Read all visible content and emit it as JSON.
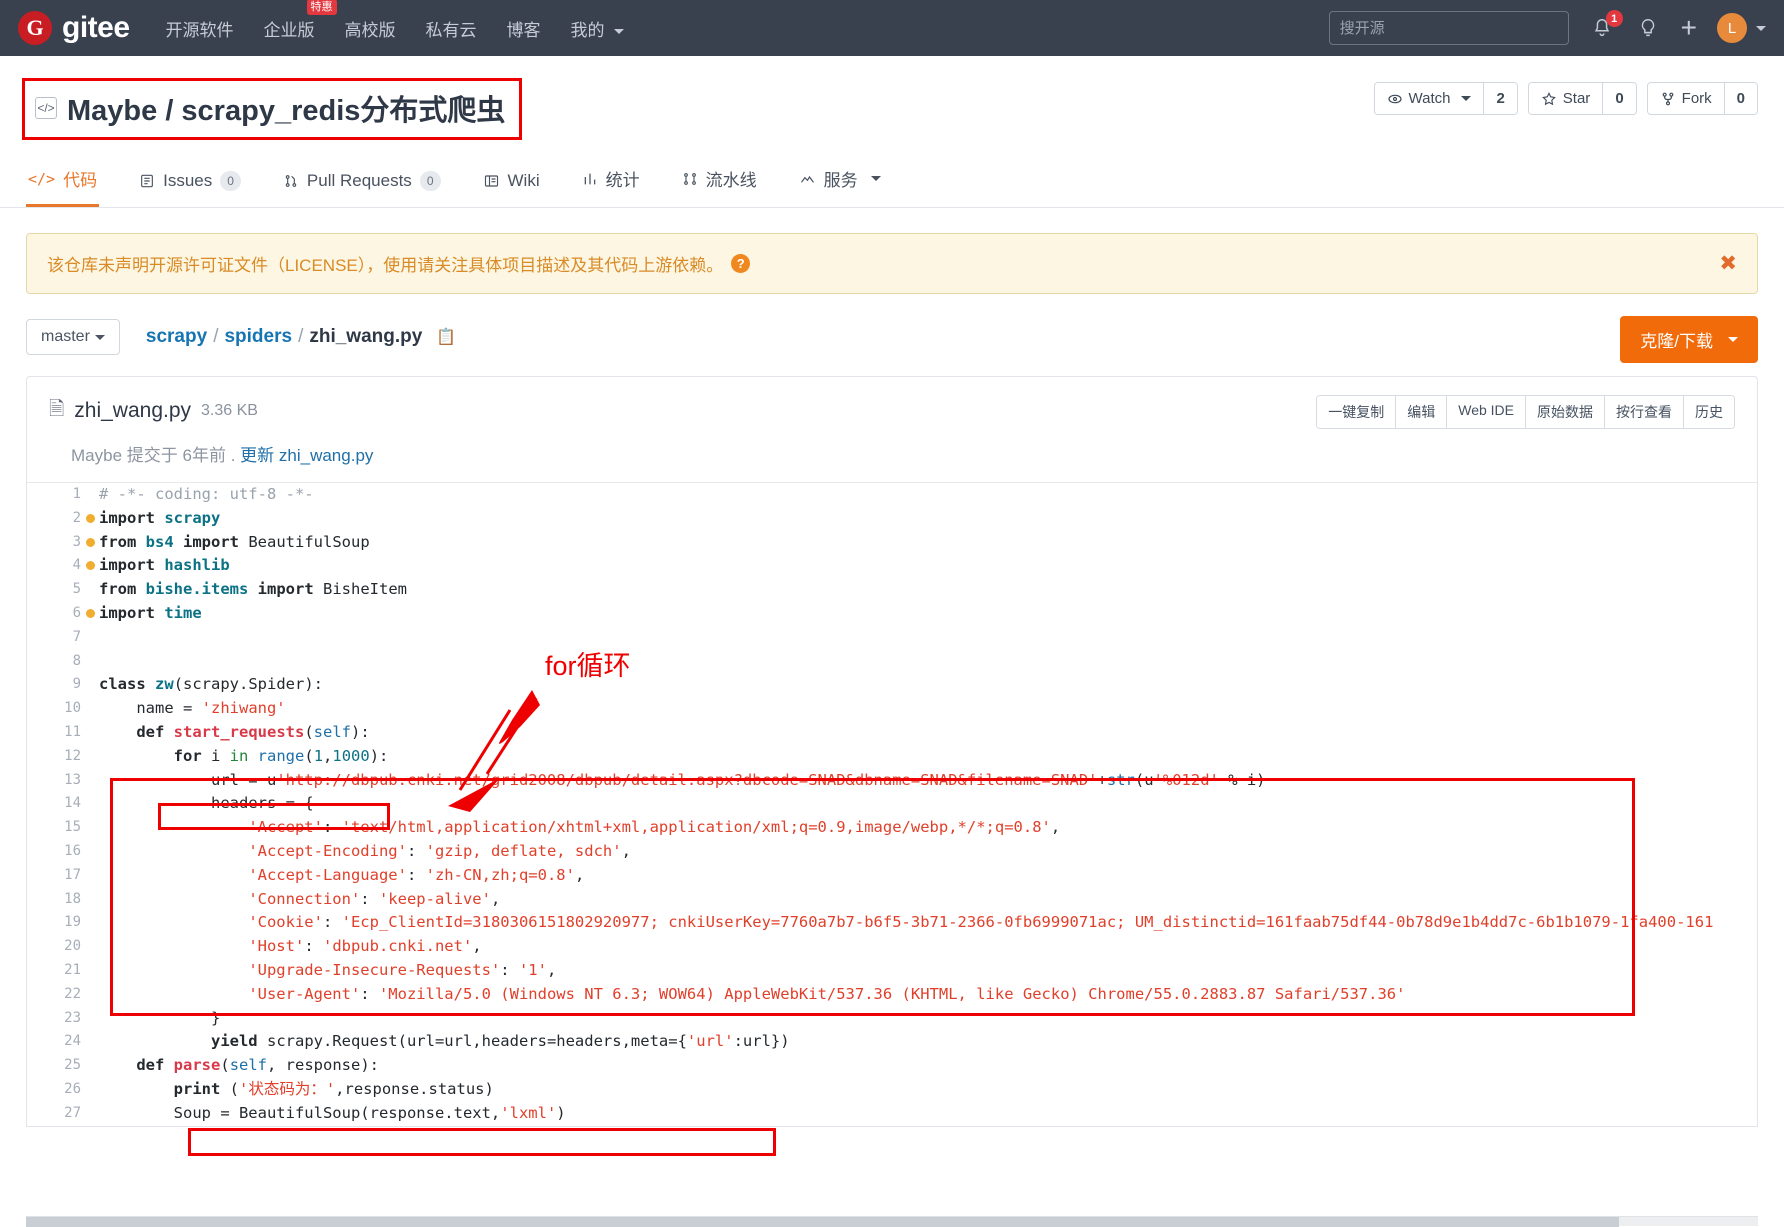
{
  "topnav": {
    "brand_mark": "G",
    "brand_text": "gitee",
    "links": [
      {
        "label": "开源软件",
        "badge": null
      },
      {
        "label": "企业版",
        "badge": "特惠"
      },
      {
        "label": "高校版",
        "badge": null
      },
      {
        "label": "私有云",
        "badge": null
      },
      {
        "label": "博客",
        "badge": null
      },
      {
        "label": "我的",
        "badge": null,
        "caret": true
      }
    ],
    "search_placeholder": "搜开源",
    "notification_count": "1",
    "bell_icon": "bell-icon",
    "lightbulb_icon": "lightbulb-icon",
    "plus_icon": "plus-icon",
    "avatar_letter": "L"
  },
  "repo": {
    "code_badge_icon": "code-brackets-icon",
    "owner": "Maybe",
    "separator": "/",
    "name": "scrapy_redis分布式爬虫",
    "full_title": "Maybe / scrapy_redis分布式爬虫",
    "actions": [
      {
        "icon": "eye-icon",
        "label": "Watch",
        "count": "2",
        "caret": true
      },
      {
        "icon": "star-icon",
        "label": "Star",
        "count": "0",
        "caret": false
      },
      {
        "icon": "fork-icon",
        "label": "Fork",
        "count": "0",
        "caret": false
      }
    ],
    "tabs": [
      {
        "icon": "code-icon",
        "label": "代码",
        "count": null,
        "active": true
      },
      {
        "icon": "issues-icon",
        "label": "Issues",
        "count": "0",
        "active": false
      },
      {
        "icon": "pull-request-icon",
        "label": "Pull Requests",
        "count": "0",
        "active": false
      },
      {
        "icon": "wiki-icon",
        "label": "Wiki",
        "count": null,
        "active": false
      },
      {
        "icon": "chart-icon",
        "label": "统计",
        "count": null,
        "active": false
      },
      {
        "icon": "pipeline-icon",
        "label": "流水线",
        "count": null,
        "active": false
      },
      {
        "icon": "service-icon",
        "label": "服务",
        "count": null,
        "active": false,
        "caret": true
      }
    ]
  },
  "notice": {
    "text": "该仓库未声明开源许可证文件（LICENSE），使用请关注具体项目描述及其代码上游依赖。",
    "help_icon": "question-mark-icon",
    "close_icon": "close-icon"
  },
  "path_row": {
    "branch": "master",
    "breadcrumb": [
      {
        "label": "scrapy",
        "type": "link"
      },
      {
        "label": "/",
        "type": "sep"
      },
      {
        "label": "spiders",
        "type": "link"
      },
      {
        "label": "/",
        "type": "sep"
      },
      {
        "label": "zhi_wang.py",
        "type": "current"
      }
    ],
    "copy_icon": "copy-icon",
    "clone_label": "克隆/下载"
  },
  "file": {
    "icon": "file-text-icon",
    "name": "zhi_wang.py",
    "size": "3.36 KB",
    "toolbar": [
      "一键复制",
      "编辑",
      "Web IDE",
      "原始数据",
      "按行查看",
      "历史"
    ],
    "commit_author": "Maybe",
    "commit_prefix": "提交于",
    "commit_time": "6年前",
    "commit_dot": ".",
    "commit_message": "更新 zhi_wang.py"
  },
  "annotations": {
    "for_loop_label": "for循环"
  },
  "code": {
    "lines": [
      {
        "n": "1",
        "dot": false,
        "html": "<span class='c'># -*- coding: utf-8 -*-</span>"
      },
      {
        "n": "2",
        "dot": true,
        "html": "<span class='k'>import</span> <span class='kb'>scrapy</span>"
      },
      {
        "n": "3",
        "dot": true,
        "html": "<span class='k'>from</span> <span class='kb'>bs4</span> <span class='k'>import</span> BeautifulSoup"
      },
      {
        "n": "4",
        "dot": true,
        "html": "<span class='k'>import</span> <span class='kb'>hashlib</span>"
      },
      {
        "n": "5",
        "dot": false,
        "html": "<span class='k'>from</span> <span class='kb'>bishe.items</span> <span class='k'>import</span> BisheItem"
      },
      {
        "n": "6",
        "dot": true,
        "html": "<span class='k'>import</span> <span class='kb'>time</span>"
      },
      {
        "n": "7",
        "dot": false,
        "html": ""
      },
      {
        "n": "8",
        "dot": false,
        "html": ""
      },
      {
        "n": "9",
        "dot": false,
        "html": "<span class='k'>class</span> <span class='kb'>zw</span>(scrapy.Spider):"
      },
      {
        "n": "10",
        "dot": false,
        "html": "    name = <span class='s'>'zhiwang'</span>"
      },
      {
        "n": "11",
        "dot": false,
        "html": "    <span class='k'>def</span> <span class='fn'>start_requests</span>(<span class='nm'>self</span>):"
      },
      {
        "n": "12",
        "dot": false,
        "html": "        <span class='k'>for</span> i <span class='g'>in</span> <span class='nm'>range</span>(<span class='n'>1</span>,<span class='n'>1000</span>):"
      },
      {
        "n": "13",
        "dot": false,
        "html": "            url = u<span class='s'>'http://dbpub.cnki.net/grid2008/dbpub/detail.aspx?dbcode=SNAD&dbname=SNAD&filename=SNAD'</span>+<span class='nm'>str</span>(u<span class='s'>'%012d'</span> % i)"
      },
      {
        "n": "14",
        "dot": false,
        "html": "            headers = {"
      },
      {
        "n": "15",
        "dot": false,
        "html": "                <span class='s'>'Accept'</span>: <span class='s'>'text/html,application/xhtml+xml,application/xml;q=0.9,image/webp,*/*;q=0.8'</span>,"
      },
      {
        "n": "16",
        "dot": false,
        "html": "                <span class='s'>'Accept-Encoding'</span>: <span class='s'>'gzip, deflate, sdch'</span>,"
      },
      {
        "n": "17",
        "dot": false,
        "html": "                <span class='s'>'Accept-Language'</span>: <span class='s'>'zh-CN,zh;q=0.8'</span>,"
      },
      {
        "n": "18",
        "dot": false,
        "html": "                <span class='s'>'Connection'</span>: <span class='s'>'keep-alive'</span>,"
      },
      {
        "n": "19",
        "dot": false,
        "html": "                <span class='s'>'Cookie'</span>: <span class='s'>'Ecp_ClientId=3180306151802920977; cnkiUserKey=7760a7b7-b6f5-3b71-2366-0fb6999071ac; UM_distinctid=161faab75df44-0b78d9e1b4dd7c-6b1b1079-1fa400-161</span>"
      },
      {
        "n": "20",
        "dot": false,
        "html": "                <span class='s'>'Host'</span>: <span class='s'>'dbpub.cnki.net'</span>,"
      },
      {
        "n": "21",
        "dot": false,
        "html": "                <span class='s'>'Upgrade-Insecure-Requests'</span>: <span class='s'>'1'</span>,"
      },
      {
        "n": "22",
        "dot": false,
        "html": "                <span class='s'>'User-Agent'</span>: <span class='s'>'Mozilla/5.0 (Windows NT 6.3; WOW64) AppleWebKit/537.36 (KHTML, like Gecko) Chrome/55.0.2883.87 Safari/537.36'</span>"
      },
      {
        "n": "23",
        "dot": false,
        "html": "            }"
      },
      {
        "n": "24",
        "dot": false,
        "html": "            <span class='k'>yield</span> scrapy.Request(url=url,headers=headers,meta={<span class='s'>'url'</span>:url})"
      },
      {
        "n": "25",
        "dot": false,
        "html": "    <span class='k'>def</span> <span class='fn'>parse</span>(<span class='nm'>self</span>, response):"
      },
      {
        "n": "26",
        "dot": false,
        "html": "        <span class='k'>print</span> (<span class='s'>'状态码为：'</span>,response.status)"
      },
      {
        "n": "27",
        "dot": false,
        "html": "        Soup = BeautifulSoup(response.text,<span class='s'>'lxml'</span>)"
      }
    ]
  }
}
